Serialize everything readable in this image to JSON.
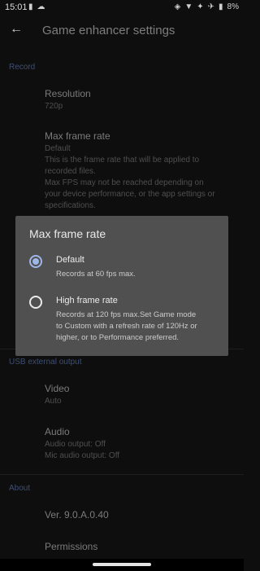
{
  "status": {
    "time": "15:01",
    "left_icons": [
      "sim-icon",
      "cloud-icon"
    ],
    "right_icons": [
      "vibrate-icon",
      "wifi-icon",
      "bluetooth-icon",
      "airplane-icon",
      "battery-icon"
    ],
    "battery": "8%"
  },
  "toolbar": {
    "title": "Game enhancer settings",
    "back_icon": "arrow-left-icon"
  },
  "sections": {
    "record": "Record",
    "usb": "USB external output",
    "about": "About"
  },
  "items": {
    "resolution": {
      "title": "Resolution",
      "value": "720p"
    },
    "max_frame_rate": {
      "title": "Max frame rate",
      "value": "Default",
      "desc1": "This is the frame rate that will be applied to",
      "desc2": "recorded files.",
      "desc3": "Max FPS may not be reached depending on",
      "desc4": "your device performance, or the app settings or",
      "desc5": "specifications."
    },
    "video": {
      "title": "Video",
      "value": "Auto"
    },
    "audio": {
      "title": "Audio",
      "value1": "Audio output: Off",
      "value2": "Mic audio output: Off"
    },
    "version": {
      "title": "Ver. 9.0.A.0.40"
    },
    "permissions": {
      "title": "Permissions"
    }
  },
  "dialog": {
    "title": "Max frame rate",
    "options": [
      {
        "label": "Default",
        "desc": "Records at 60 fps max.",
        "selected": true
      },
      {
        "label": "High frame rate",
        "desc1": "Records at 120 fps max.Set Game mode",
        "desc2": "to Custom with a refresh rate of 120Hz or",
        "desc3": "higher, or to Performance preferred.",
        "selected": false
      }
    ]
  },
  "colors": {
    "accent": "#9fb6e8",
    "dialog_bg": "#505050",
    "section": "#3e4f74"
  }
}
